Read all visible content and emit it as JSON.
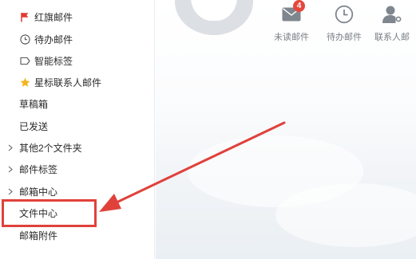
{
  "sidebar": {
    "items": [
      {
        "label": "红旗邮件",
        "icon": "red-flag-icon"
      },
      {
        "label": "待办邮件",
        "icon": "clock-icon"
      },
      {
        "label": "智能标签",
        "icon": "tag-icon"
      },
      {
        "label": "星标联系人邮件",
        "icon": "star-icon"
      },
      {
        "label": "草稿箱"
      },
      {
        "label": "已发送"
      },
      {
        "label": "其他2个文件夹",
        "icon": "chevron-right-icon"
      },
      {
        "label": "邮件标签",
        "icon": "chevron-right-icon"
      },
      {
        "label": "邮箱中心",
        "icon": "chevron-right-icon"
      },
      {
        "label": "文件中心"
      },
      {
        "label": "邮箱附件"
      }
    ]
  },
  "toolbar": {
    "unread": {
      "label": "未读邮件",
      "badge": "4",
      "icon": "envelope-icon"
    },
    "todo": {
      "label": "待办邮件",
      "icon": "clock-icon"
    },
    "contacts": {
      "label": "联系人邮",
      "icon": "person-icon"
    }
  },
  "colors": {
    "highlight": "#e0413b",
    "arrow": "#e0413b",
    "badge": "#e5473e",
    "flag": "#e03a32",
    "star": "#f4b41a"
  }
}
